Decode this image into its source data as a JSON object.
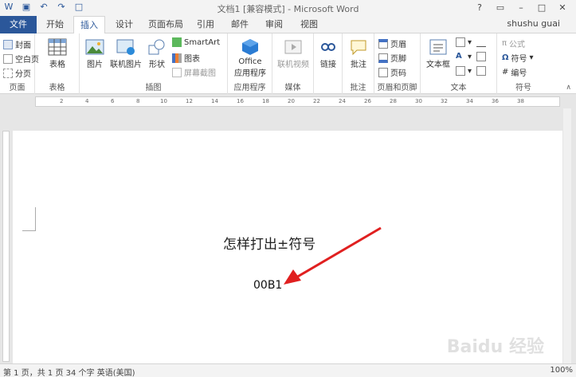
{
  "window": {
    "title": "文档1 [兼容模式] - Microsoft Word",
    "user": "shushu guai"
  },
  "tabs": [
    "文件",
    "开始",
    "插入",
    "设计",
    "页面布局",
    "引用",
    "邮件",
    "审阅",
    "视图"
  ],
  "active_tab": "插入",
  "ribbon": {
    "pages": {
      "cover": "封面",
      "blank": "空白页",
      "break": "分页",
      "label": "页面"
    },
    "tables": {
      "table": "表格",
      "label": "表格"
    },
    "illustrations": {
      "pictures": "图片",
      "online_pictures": "联机图片",
      "shapes": "形状",
      "smartart": "SmartArt",
      "chart": "图表",
      "screenshot": "屏幕截图",
      "label": "插图"
    },
    "apps": {
      "office": "Office",
      "store": "应用程序",
      "label": "应用程序"
    },
    "media": {
      "online_video": "联机视频",
      "label": "媒体"
    },
    "links": {
      "link": "链接"
    },
    "comments": {
      "comment": "批注",
      "label": "批注"
    },
    "header_footer": {
      "header": "页眉",
      "footer": "页脚",
      "page_number": "页码",
      "label": "页眉和页脚"
    },
    "text": {
      "textbox": "文本框",
      "label": "文本"
    },
    "symbols": {
      "equation": "公式",
      "symbol": "符号",
      "number": "编号",
      "label": "符号"
    }
  },
  "ruler_numbers": [
    "2",
    "4",
    "6",
    "8",
    "10",
    "12",
    "14",
    "16",
    "18",
    "20",
    "22",
    "24",
    "26",
    "28",
    "30",
    "32",
    "34",
    "36",
    "38"
  ],
  "document": {
    "line1": "怎样打出±符号",
    "line2": "00B1"
  },
  "status": {
    "left": "第 1 页，共 1 页    34 个字    英语(美国)",
    "zoom": "100%"
  },
  "colors": {
    "brand": "#2b579a",
    "arrow": "#e02020"
  },
  "watermark": "Baidu 经验"
}
